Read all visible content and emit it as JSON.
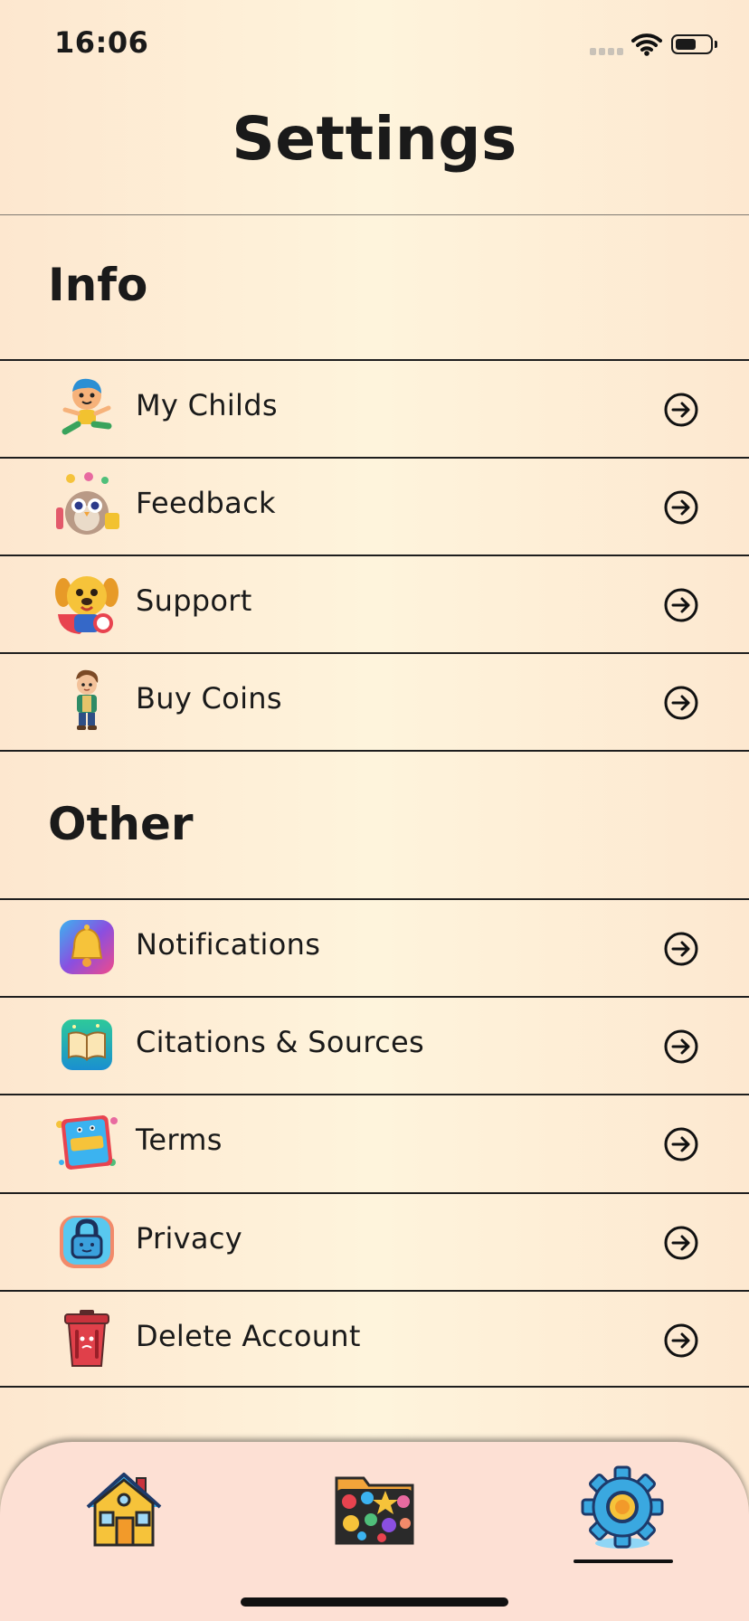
{
  "status_bar": {
    "time": "16:06"
  },
  "header": {
    "title": "Settings"
  },
  "sections": {
    "info": {
      "title": "Info",
      "items": [
        {
          "label": "My Childs",
          "icon": "running-child-icon"
        },
        {
          "label": "Feedback",
          "icon": "owl-feedback-icon"
        },
        {
          "label": "Support",
          "icon": "puppy-support-icon"
        },
        {
          "label": "Buy Coins",
          "icon": "boy-character-icon"
        }
      ]
    },
    "other": {
      "title": "Other",
      "items": [
        {
          "label": "Notifications",
          "icon": "bell-icon"
        },
        {
          "label": "Citations & Sources",
          "icon": "open-book-icon"
        },
        {
          "label": "Terms",
          "icon": "tos-book-icon"
        },
        {
          "label": "Privacy",
          "icon": "padlock-icon"
        },
        {
          "label": "Delete Account",
          "icon": "trash-can-icon"
        }
      ]
    }
  },
  "tab_bar": {
    "tabs": [
      {
        "icon": "house-icon",
        "active": false
      },
      {
        "icon": "folder-stickers-icon",
        "active": false
      },
      {
        "icon": "gear-icon",
        "active": true
      }
    ]
  },
  "colors": {
    "background": "#fef2da",
    "tab_bar": "#fde0d4",
    "text": "#1a1a1a"
  }
}
